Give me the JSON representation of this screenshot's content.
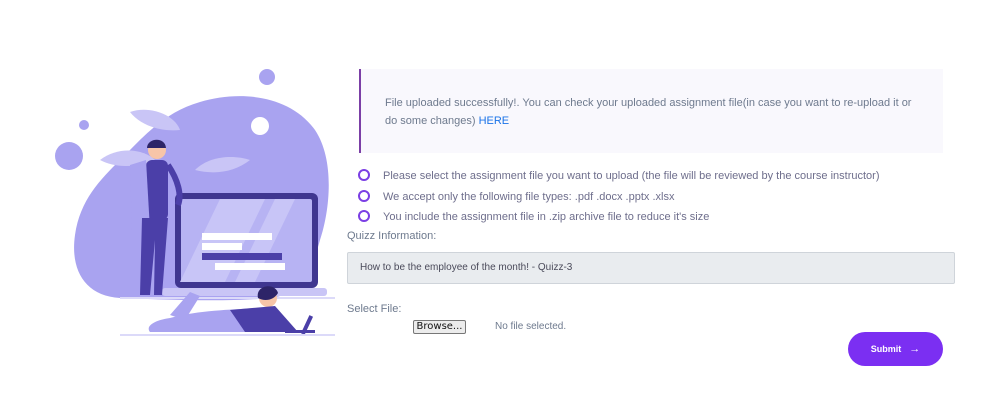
{
  "alert": {
    "message": "File uploaded successfully!. You can check your uploaded assignment file(in case you want to re-upload it or do some changes)",
    "link_text": "HERE"
  },
  "rules": [
    "Please select the assignment file you want to upload (the file will be reviewed by the course instructor)",
    "We accept only the following file types: .pdf .docx .pptx .xlsx",
    "You include the assignment file in .zip archive file to reduce it's size"
  ],
  "quiz": {
    "label": "Quizz Information:",
    "value": "How to be the employee of the month! - Quizz-3"
  },
  "file": {
    "label": "Select File:",
    "browse_label": "Browse...",
    "status": "No file selected."
  },
  "submit": {
    "label": "Submit",
    "arrow": "→"
  },
  "colors": {
    "accent": "#7b2ff2",
    "illustration_primary": "#a9a3f0",
    "illustration_dark": "#4b3fa8"
  },
  "icons": {
    "bullet": "circle-outline-icon",
    "submit_arrow": "arrow-right-icon"
  }
}
